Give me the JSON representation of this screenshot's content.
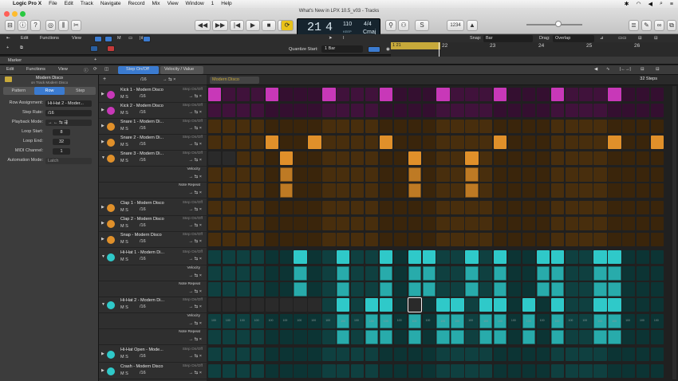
{
  "menubar": {
    "apple": "",
    "items": [
      "Logic Pro X",
      "File",
      "Edit",
      "Track",
      "Navigate",
      "Record",
      "Mix",
      "View",
      "Window",
      "1",
      "Help"
    ]
  },
  "window": {
    "title": "What's New in LPX 10.5_v03 - Tracks"
  },
  "lcd": {
    "bar": "21",
    "beat": "4",
    "bar_label": "BAR",
    "beat_label": "BEAT",
    "tempo": "110",
    "tempo_sub": "KEEP",
    "tempo_label": "TEMPO",
    "timesig": "4/4",
    "key": "Cmaj",
    "key_label": "",
    "shortcut": "1234"
  },
  "ctrlbar": {
    "edit": "Edit",
    "functions": "Functions",
    "view": "View",
    "quantize_label": "Quantize Start:",
    "quantize_value": "1 Bar",
    "snap_label": "Snap:",
    "snap_value": "Bar",
    "drag_label": "Drag:",
    "drag_value": "Overlap",
    "marker_label": "Marker"
  },
  "ruler": {
    "numbers": [
      "21",
      "22",
      "23",
      "24",
      "25",
      "26"
    ],
    "region_label": "1 21"
  },
  "editor": {
    "edit": "Edit",
    "functions": "Functions",
    "view": "View",
    "step_onoff": "Step On/Off",
    "velocity_value": "Velocity / Value",
    "pattern_name": "Modern Disco",
    "steps": "32 Steps",
    "step_rate": "/16"
  },
  "inspector": {
    "title": "Modern Disco",
    "subtitle": "on Track Modern Disco",
    "tabs": [
      "Pattern",
      "Row",
      "Step"
    ],
    "rows": [
      {
        "label": "Row Assignment:",
        "value": "Hi-Hat 2 - Moder..."
      },
      {
        "label": "Step Rate:",
        "value": "/16"
      },
      {
        "label": "Playback Mode:",
        "value": "→  ←  ⇆  ⇶"
      },
      {
        "label": "Loop Start:",
        "value": "8"
      },
      {
        "label": "Loop End:",
        "value": "32"
      },
      {
        "label": "MIDI Channel:",
        "value": "1"
      },
      {
        "label": "Automation Mode:",
        "value": "Latch"
      }
    ]
  },
  "tracks": [
    {
      "name": "Kick 1 - Modern Disco",
      "icon": "kick-icon",
      "color": "#c838b8"
    },
    {
      "name": "Kick 2 - Modern Disco",
      "icon": "kick-icon",
      "color": "#c838b8"
    },
    {
      "name": "Snare 1 - Modern Di...",
      "icon": "snare-icon",
      "color": "#e0902a"
    },
    {
      "name": "Snare 2 - Modern Di...",
      "icon": "snare-icon",
      "color": "#e0902a"
    },
    {
      "name": "Snare 3 - Modern Di...",
      "icon": "snare-icon",
      "color": "#e0902a"
    },
    {
      "name": "Clap 1 - Modern Disco",
      "icon": "hand-icon",
      "color": "#e0902a"
    },
    {
      "name": "Clap 2 - Modern Disco",
      "icon": "hand-icon",
      "color": "#e0902a"
    },
    {
      "name": "Snap - Modern Disco",
      "icon": "hand-icon",
      "color": "#e0902a"
    },
    {
      "name": "Hi-Hat 1 - Modern Di...",
      "icon": "hihat-icon",
      "color": "#2fc9c9"
    },
    {
      "name": "Hi-Hat 2 - Modern Di...",
      "icon": "hihat-icon",
      "color": "#2fc9c9"
    },
    {
      "name": "Hi-Hat Open - Mode...",
      "icon": "hihat-icon",
      "color": "#2fc9c9"
    },
    {
      "name": "Crash - Modern Disco",
      "icon": "cymbal-icon",
      "color": "#2fc9c9"
    }
  ],
  "track_common": {
    "step_onoff": "Step On/Off",
    "ms": "M  S",
    "rate": "/16",
    "arrows": "→ ⇆ ×"
  },
  "sublanes": {
    "velocity": "Velocity",
    "note_repeat": "Note Repeat"
  },
  "velocity_values": "100",
  "colors": {
    "kick": "#c838b8",
    "snare": "#e0902a",
    "hihat": "#2fc9c9"
  }
}
